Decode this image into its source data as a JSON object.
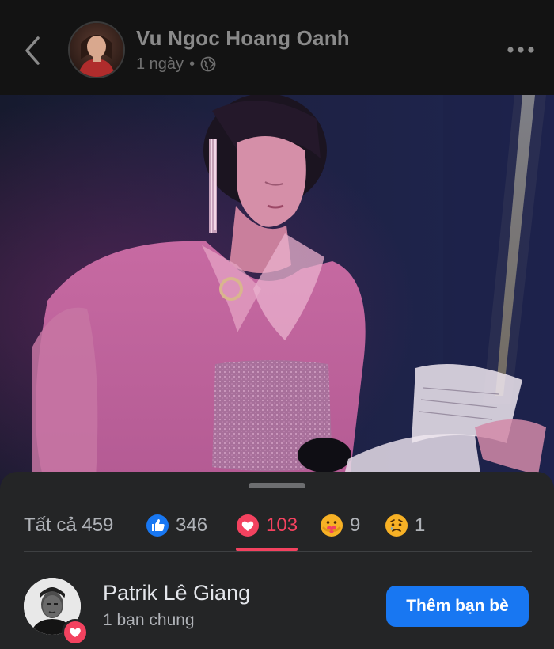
{
  "header": {
    "author_name": "Vu Ngoc Hoang Oanh",
    "timestamp": "1 ngày",
    "separator": "•",
    "privacy_icon": "globe-icon",
    "back_icon": "chevron-left-icon",
    "more_icon": "more-horizontal-icon"
  },
  "photo": {
    "description_icon": "post-photo"
  },
  "reactions": {
    "tabs": [
      {
        "label": "Tất cả 459",
        "icon": "",
        "active": false
      },
      {
        "label": "346",
        "icon": "like-icon",
        "active": false
      },
      {
        "label": "103",
        "icon": "love-icon",
        "active": true
      },
      {
        "label": "9",
        "icon": "care-icon",
        "active": false
      },
      {
        "label": "1",
        "icon": "sad-icon",
        "active": false
      }
    ],
    "active_color": "#f3425f"
  },
  "user": {
    "name": "Patrik Lê Giang",
    "mutual": "1 bạn chung",
    "button_label": "Thêm bạn bè",
    "reaction_badge": "love-icon"
  },
  "colors": {
    "accent_blue": "#1877f2",
    "love_red": "#f3425f",
    "sheet_bg": "#242526"
  }
}
